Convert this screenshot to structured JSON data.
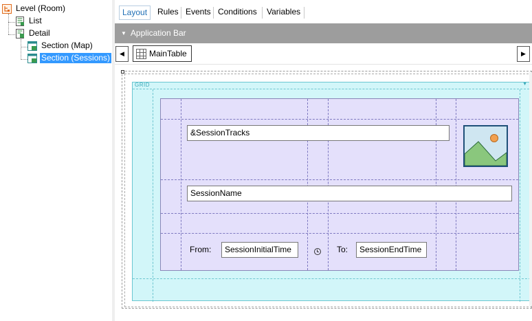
{
  "tree": {
    "root": "Level (Room)",
    "list": "List",
    "detail": "Detail",
    "section_map": "Section (Map)",
    "section_sessions": "Section (Sessions)"
  },
  "tabs": [
    "Layout",
    "Rules",
    "Events",
    "Conditions",
    "Variables"
  ],
  "active_tab": "Layout",
  "app_bar": {
    "label": "Application Bar"
  },
  "table_bar": {
    "main_table": "MainTable"
  },
  "grid": {
    "label": "GRID",
    "session_tracks": "&SessionTracks",
    "session_name": "SessionName",
    "from_label": "From:",
    "session_initial_time": "SessionInitialTime",
    "to_label": "To:",
    "session_end_time": "SessionEndTime"
  },
  "colors": {
    "selection": "#3399ff",
    "active_tab_text": "#1f6fb5",
    "app_bar": "#9d9d9d",
    "grid_bg": "#d2f6f9",
    "table_bg": "#e4e0fb"
  },
  "icons": [
    "level-icon",
    "list-icon",
    "detail-icon",
    "section-icon",
    "table-icon",
    "image-icon",
    "clock-icon"
  ]
}
